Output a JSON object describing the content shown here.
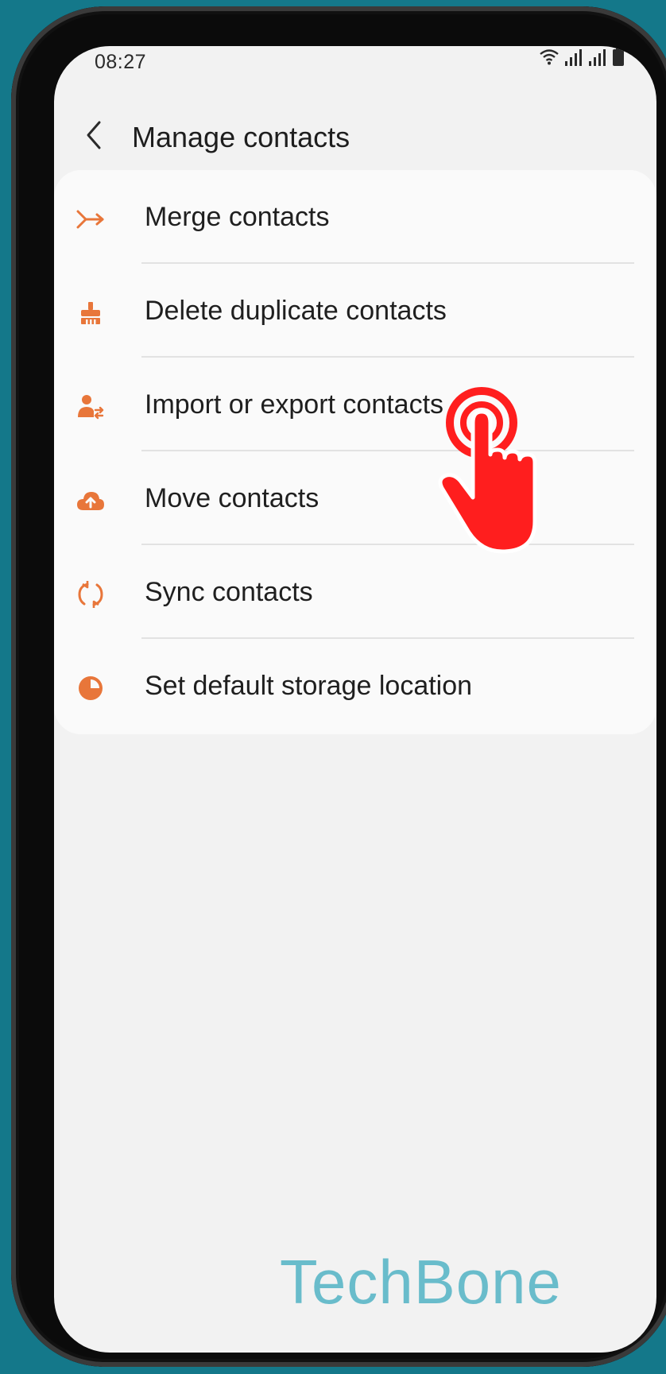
{
  "status_bar": {
    "time": "08:27",
    "icons": [
      "wifi-icon",
      "signal-icon",
      "signal-icon",
      "battery-icon"
    ]
  },
  "header": {
    "back_icon": "chevron-left-icon",
    "title": "Manage contacts"
  },
  "menu": {
    "items": [
      {
        "label": "Merge contacts",
        "icon": "merge-icon"
      },
      {
        "label": "Delete duplicate contacts",
        "icon": "broom-icon"
      },
      {
        "label": "Import or export contacts",
        "icon": "person-swap-icon"
      },
      {
        "label": "Move contacts",
        "icon": "cloud-upload-icon"
      },
      {
        "label": "Sync contacts",
        "icon": "sync-icon"
      },
      {
        "label": "Set default storage location",
        "icon": "pie-chart-icon"
      }
    ]
  },
  "overlay": {
    "tap_indicator": "tap-hand-icon"
  },
  "watermark": "TechBone",
  "colors": {
    "background": "#14788a",
    "screen": "#f2f2f2",
    "card": "#fafafa",
    "accent_orange": "#e8763a",
    "tap_red": "#ff1e1e",
    "watermark": "#69bccb"
  }
}
